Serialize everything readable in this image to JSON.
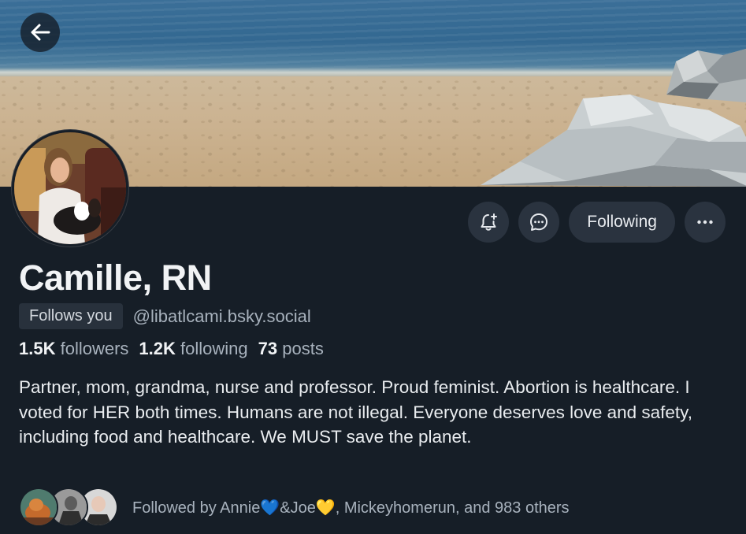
{
  "profile": {
    "display_name": "Camille, RN",
    "follows_you_label": "Follows you",
    "handle": "@libatlcami.bsky.social",
    "bio": "Partner, mom, grandma, nurse and professor. Proud feminist. Abortion is healthcare. I voted for HER both times. Humans are not illegal. Everyone deserves love and safety, including food and healthcare. We MUST save the planet."
  },
  "stats": {
    "followers_count": "1.5K",
    "followers_label": "followers",
    "following_count": "1.2K",
    "following_label": "following",
    "posts_count": "73",
    "posts_label": "posts"
  },
  "actions": {
    "following_label": "Following",
    "notify_icon": "bell-plus-icon",
    "message_icon": "chat-bubble-icon",
    "more_icon": "ellipsis-icon"
  },
  "nav": {
    "back_icon": "arrow-left-icon"
  },
  "followed_by": {
    "text": "Followed by Annie💙&Joe💛, Mickeyhomerun, and 983 others"
  },
  "colors": {
    "background": "#161e27",
    "button_bg": "#2a333f",
    "muted_text": "#a8b2bd"
  }
}
